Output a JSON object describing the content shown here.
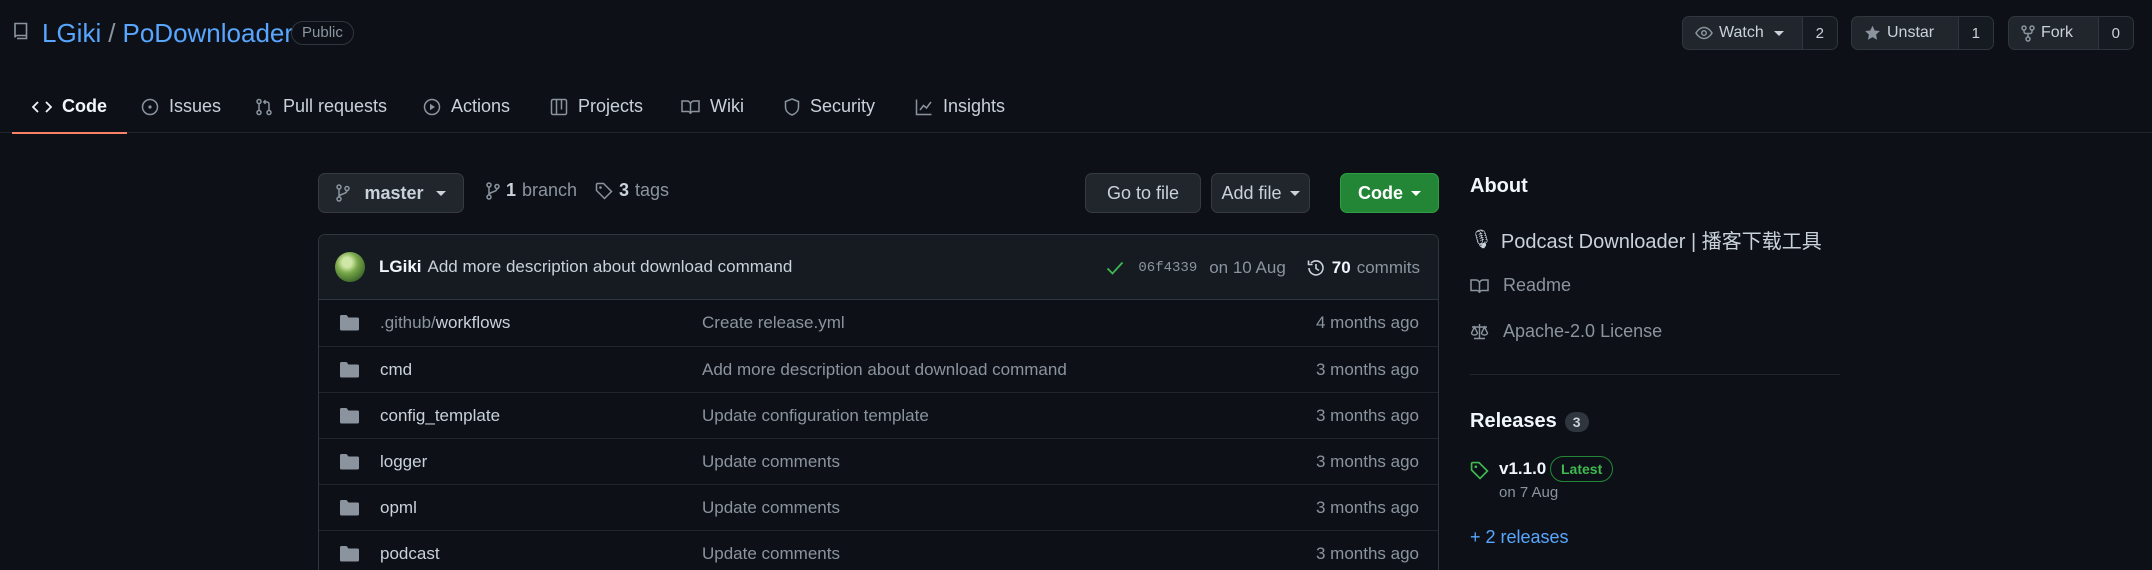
{
  "repo": {
    "owner": "LGiki",
    "name": "PoDownloader",
    "visibility": "Public"
  },
  "actions": {
    "watch_label": "Watch",
    "watch_count": "2",
    "star_label": "Unstar",
    "star_count": "1",
    "fork_label": "Fork",
    "fork_count": "0"
  },
  "tabs": [
    {
      "label": "Code",
      "icon": "code-icon",
      "active": true
    },
    {
      "label": "Issues",
      "icon": "issue-opened-icon"
    },
    {
      "label": "Pull requests",
      "icon": "git-pull-request-icon"
    },
    {
      "label": "Actions",
      "icon": "play-icon"
    },
    {
      "label": "Projects",
      "icon": "table-icon"
    },
    {
      "label": "Wiki",
      "icon": "book-icon"
    },
    {
      "label": "Security",
      "icon": "shield-icon"
    },
    {
      "label": "Insights",
      "icon": "graph-icon"
    }
  ],
  "toolbar": {
    "branch": "master",
    "branch_count": "1",
    "branch_word": "branch",
    "tag_count": "3",
    "tag_word": "tags",
    "go_to_file": "Go to file",
    "add_file": "Add file",
    "code": "Code"
  },
  "latest_commit": {
    "author": "LGiki",
    "message": "Add more description about download command",
    "sha": "06f4339",
    "date": "on 10 Aug",
    "count": "70",
    "count_word": "commits"
  },
  "files": [
    {
      "dim": ".github/",
      "name": "workflows",
      "message": "Create release.yml",
      "age": "4 months ago"
    },
    {
      "dim": "",
      "name": "cmd",
      "message": "Add more description about download command",
      "age": "3 months ago"
    },
    {
      "dim": "",
      "name": "config_template",
      "message": "Update configuration template",
      "age": "3 months ago"
    },
    {
      "dim": "",
      "name": "logger",
      "message": "Update comments",
      "age": "3 months ago"
    },
    {
      "dim": "",
      "name": "opml",
      "message": "Update comments",
      "age": "3 months ago"
    },
    {
      "dim": "",
      "name": "podcast",
      "message": "Update comments",
      "age": "3 months ago"
    }
  ],
  "about": {
    "heading": "About",
    "emoji": "🎙",
    "description": "Podcast Downloader | 播客下载工具",
    "readme": "Readme",
    "license": "Apache-2.0 License"
  },
  "releases": {
    "heading": "Releases",
    "count": "3",
    "version": "v1.1.0",
    "latest_label": "Latest",
    "date": "on 7 Aug",
    "more": "+ 2 releases"
  },
  "colors": {
    "background": "#0d1117",
    "link": "#58a6ff",
    "accent_tab": "#f78166",
    "green_button": "#238636",
    "success": "#3fb950"
  }
}
